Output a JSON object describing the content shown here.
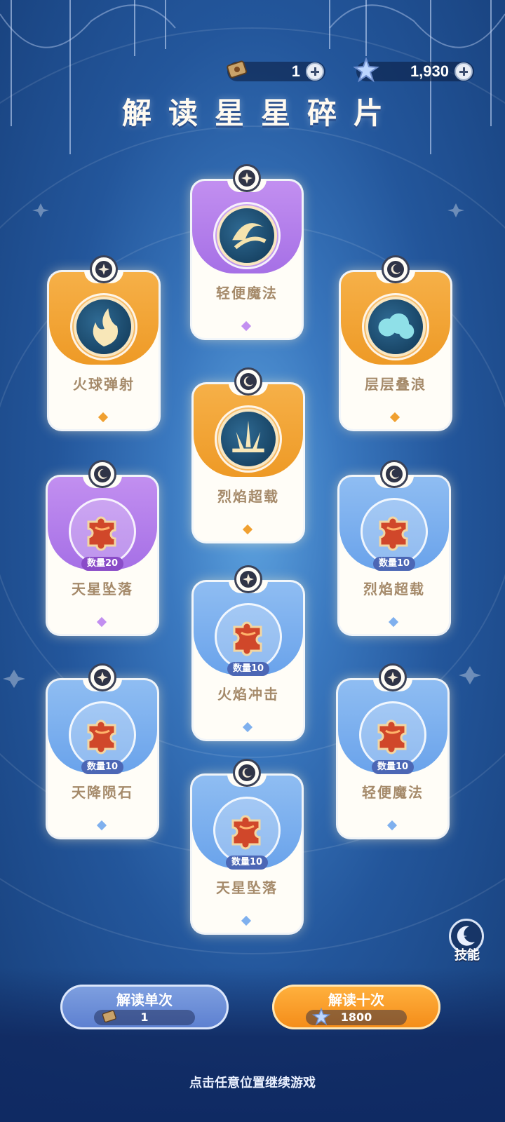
{
  "resources": {
    "scroll": {
      "icon": "scroll-ticket-icon",
      "value": "1"
    },
    "star_crystal": {
      "icon": "star-crystal-icon",
      "value": "1,930"
    }
  },
  "title": "解读星星碎片",
  "cards": [
    {
      "name": "轻便魔法",
      "color": "purple",
      "badge": "star-badge-icon",
      "art": "wind-orb-icon",
      "count": ""
    },
    {
      "name": "火球弹射",
      "color": "orange",
      "badge": "star-badge-icon",
      "art": "fireball-orb-icon",
      "count": ""
    },
    {
      "name": "层层叠浪",
      "color": "orange",
      "badge": "moon-badge-icon",
      "art": "cloud-wave-orb-icon",
      "count": ""
    },
    {
      "name": "烈焰超载",
      "color": "orange",
      "badge": "moon-badge-icon",
      "art": "flame-burst-orb-icon",
      "count": ""
    },
    {
      "name": "天星坠落",
      "color": "purple",
      "badge": "moon-badge-icon",
      "art": "puzzle-piece-icon",
      "count": "数量20"
    },
    {
      "name": "烈焰超载",
      "color": "blue",
      "badge": "moon-badge-icon",
      "art": "puzzle-piece-icon",
      "count": "数量10"
    },
    {
      "name": "火焰冲击",
      "color": "blue",
      "badge": "star-badge-icon",
      "art": "puzzle-piece-icon",
      "count": "数量10"
    },
    {
      "name": "天降陨石",
      "color": "blue",
      "badge": "star-badge-icon",
      "art": "puzzle-piece-icon",
      "count": "数量10"
    },
    {
      "name": "轻便魔法",
      "color": "blue",
      "badge": "star-badge-icon",
      "art": "puzzle-piece-icon",
      "count": "数量10"
    },
    {
      "name": "天星坠落",
      "color": "blue",
      "badge": "moon-badge-icon",
      "art": "puzzle-piece-icon",
      "count": "数量10"
    }
  ],
  "skill_button": {
    "label": "技能",
    "icon": "skill-moon-star-icon"
  },
  "buttons": {
    "single": {
      "label": "解读单次",
      "cost": "1",
      "cost_icon": "scroll-ticket-icon"
    },
    "ten": {
      "label": "解读十次",
      "cost": "1800",
      "cost_icon": "star-crystal-icon"
    }
  },
  "hint": "点击任意位置继续游戏",
  "colors": {
    "purple": "#a670e6",
    "orange": "#ee9a26",
    "blue": "#6aa3eb",
    "background": "#23569b"
  }
}
